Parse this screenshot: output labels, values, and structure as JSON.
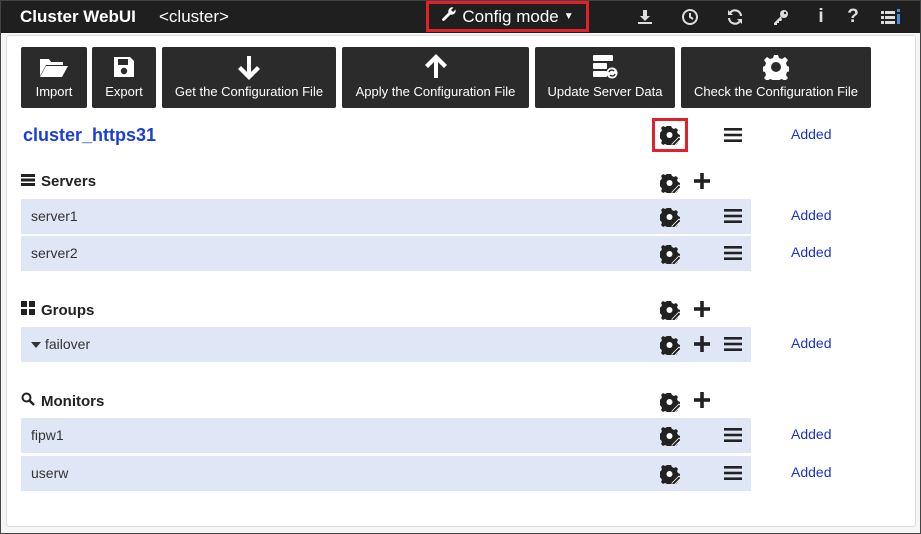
{
  "header": {
    "app_title": "Cluster WebUI",
    "cluster_tag": "<cluster>",
    "mode_label": "Config mode",
    "icons": [
      "download-icon",
      "clock-icon",
      "refresh-icon",
      "key-icon",
      "info-icon",
      "help-icon",
      "list-icon"
    ]
  },
  "toolbar": {
    "import_label": "Import",
    "export_label": "Export",
    "get_config_label": "Get the Configuration File",
    "apply_config_label": "Apply the Configuration File",
    "update_server_label": "Update Server Data",
    "check_config_label": "Check the Configuration File"
  },
  "cluster": {
    "name": "cluster_https31",
    "status": "Added"
  },
  "sections": {
    "servers": {
      "title": "Servers",
      "items": [
        {
          "name": "server1",
          "status": "Added"
        },
        {
          "name": "server2",
          "status": "Added"
        }
      ]
    },
    "groups": {
      "title": "Groups",
      "items": [
        {
          "name": "failover",
          "status": "Added"
        }
      ]
    },
    "monitors": {
      "title": "Monitors",
      "items": [
        {
          "name": "fipw1",
          "status": "Added"
        },
        {
          "name": "userw",
          "status": "Added"
        }
      ]
    }
  },
  "colors": {
    "accent_red": "#e0202a",
    "link_blue": "#1a33c8",
    "row_bg": "#dfe6f6",
    "topbar": "#1f1f1f"
  }
}
